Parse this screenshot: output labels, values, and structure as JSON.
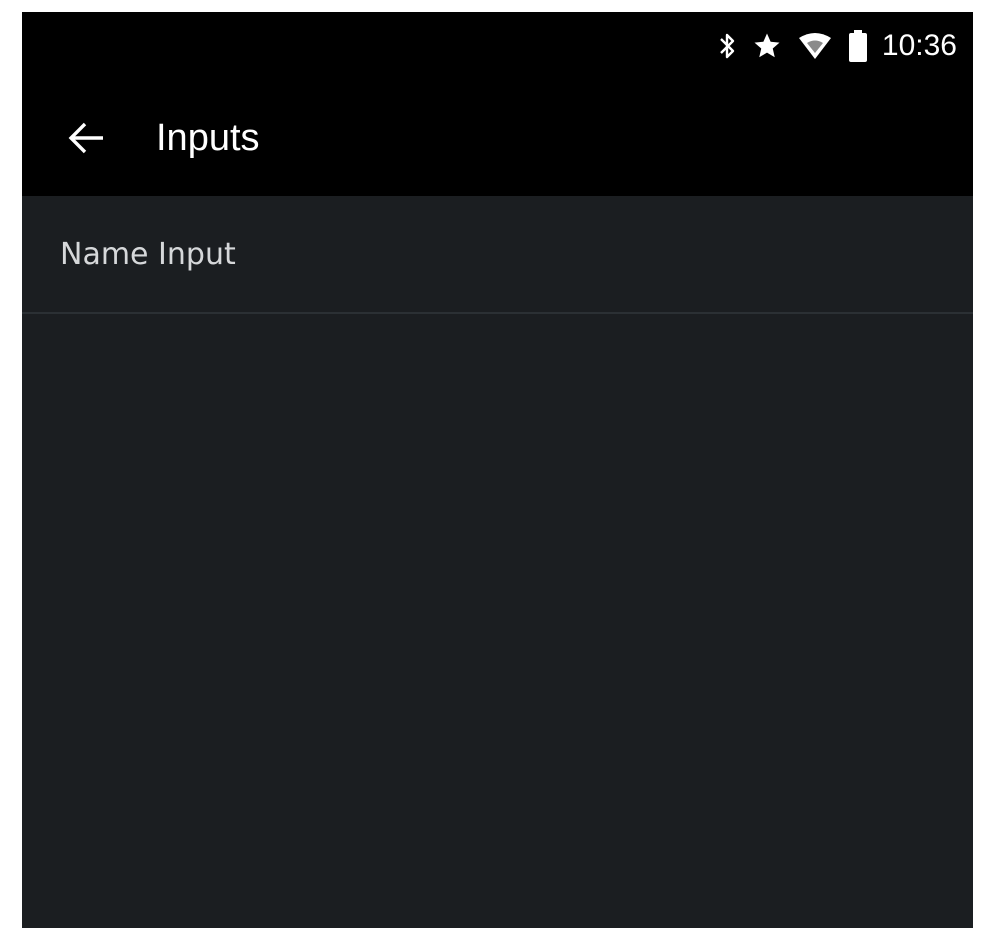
{
  "status_bar": {
    "icons": [
      "bluetooth-icon",
      "star-icon",
      "wifi-icon",
      "battery-icon"
    ],
    "time": "10:36"
  },
  "app_bar": {
    "back_icon": "arrow-left-icon",
    "title": "Inputs"
  },
  "list": {
    "items": [
      {
        "label": "Name Input"
      }
    ]
  },
  "colors": {
    "status_bar_bg": "#000000",
    "app_bar_bg": "#000000",
    "content_bg": "#1b1e21",
    "divider": "#2b3034",
    "text_primary": "#ffffff",
    "text_secondary": "#d6d8da"
  }
}
